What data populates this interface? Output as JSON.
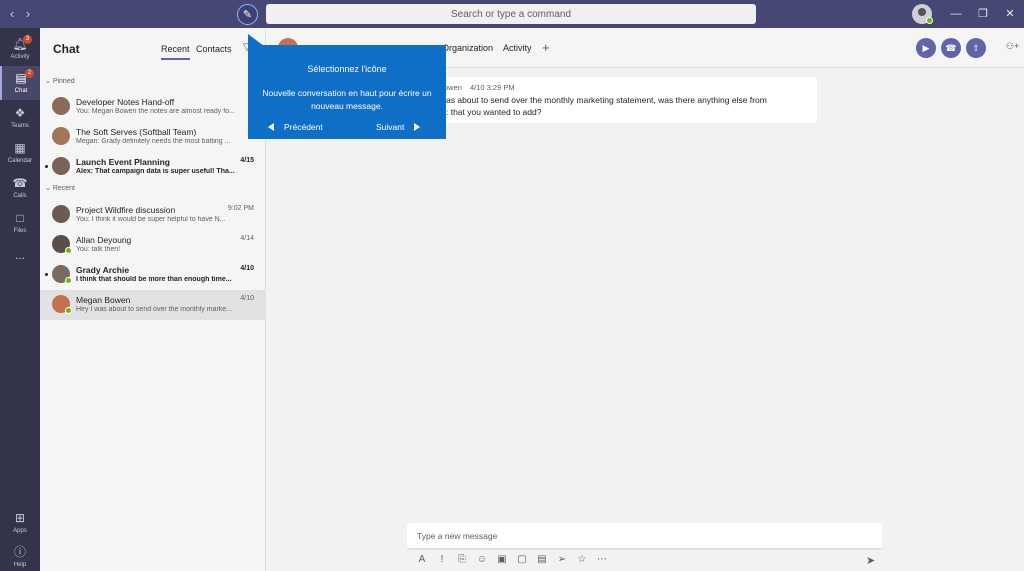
{
  "titlebar": {
    "back_icon": "chevron-left-icon",
    "forward_icon": "chevron-right-icon",
    "compose_icon": "compose-icon",
    "search_placeholder": "Search or type a command",
    "window_controls": [
      "minimize",
      "maximize",
      "close"
    ]
  },
  "rail": {
    "items": [
      {
        "label": "Activity",
        "icon": "bell-icon",
        "badge": "3"
      },
      {
        "label": "Chat",
        "icon": "chat-icon",
        "badge": "2"
      },
      {
        "label": "Teams",
        "icon": "teams-icon"
      },
      {
        "label": "Calendar",
        "icon": "calendar-icon"
      },
      {
        "label": "Calls",
        "icon": "phone-icon"
      },
      {
        "label": "Files",
        "icon": "files-icon"
      }
    ],
    "more": "...",
    "apps_label": "Apps",
    "help_label": "Help"
  },
  "chatlist": {
    "title": "Chat",
    "tabs": [
      "Recent",
      "Contacts"
    ],
    "active_tab": "Recent",
    "pinned_label": "Pinned",
    "recent_label": "Recent",
    "pinned": [
      {
        "name": "Developer Notes Hand-off",
        "date": "4/",
        "preview": "You: Megan Bowen the notes are almost ready fo...",
        "bold": false
      },
      {
        "name": "The Soft Serves (Softball Team)",
        "date": "4/",
        "preview": "Megan: Grady definitely needs the most batting ...",
        "bold": false
      },
      {
        "name": "Launch Event Planning",
        "date": "4/15",
        "preview": "Alex: That campaign data is super useful! Tha...",
        "bold": true
      }
    ],
    "recent": [
      {
        "name": "Project Wildfire discussion",
        "date": "9:02 PM",
        "preview": "You: I think it would be super helpful to have N...",
        "bold": false
      },
      {
        "name": "Allan Deyoung",
        "date": "4/14",
        "preview": "You: talk then!",
        "bold": false
      },
      {
        "name": "Grady Archie",
        "date": "4/10",
        "preview": "I think that should be more than enough time...",
        "bold": true
      },
      {
        "name": "Megan Bowen",
        "date": "4/10",
        "preview": "Hey I was about to send over the monthly marke...",
        "bold": false
      }
    ]
  },
  "conversation": {
    "header_tabs": [
      "Organization",
      "Activity"
    ],
    "add_tab": "+",
    "message": {
      "sender": "owen",
      "time": "4/10 3:29 PM",
      "line1": "as about to send over the monthly marketing statement, was there anything else from",
      "line2": ": that you wanted to add?"
    },
    "compose_placeholder": "Type a new message"
  },
  "coachmark": {
    "title": "Sélectionnez l'icône",
    "body": "Nouvelle conversation en haut pour écrire un nouveau message.",
    "prev_label": "Précédent",
    "next_label": "Suivant"
  },
  "colors": {
    "titlebar": "#464775",
    "rail": "#33344a",
    "accent": "#6264a7",
    "coachmark": "#0f6fc6"
  }
}
